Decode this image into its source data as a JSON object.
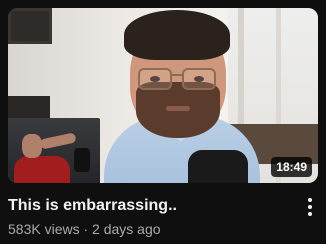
{
  "video": {
    "title": "This is embarrassing..",
    "views": "583K views",
    "separator": "·",
    "age": "2 days ago",
    "duration": "18:49"
  },
  "icons": {
    "menu": "more-vert-icon"
  },
  "colors": {
    "background": "#0f0f0f",
    "title": "#f1f1f1",
    "meta": "#aaaaaa",
    "badge_bg": "#000000"
  }
}
